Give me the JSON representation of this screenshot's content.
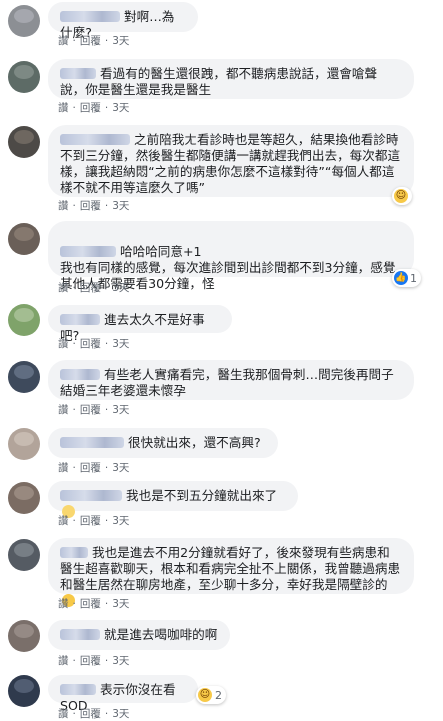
{
  "actions": {
    "read": "讚",
    "reply": "回覆",
    "time": "3天"
  },
  "comments": [
    {
      "text": "對啊…為什麼?",
      "avatar": [
        "#8c8f94",
        "#b9bcc2"
      ]
    },
    {
      "text": "看過有的醫生還很跩，都不聽病患說話，還會嗆聲說，你是醫生還是我是醫生",
      "avatar": [
        "#5d6b66",
        "#98a29c"
      ]
    },
    {
      "text": "之前陪我ㄤ看診時也是等超久，結果換他看診時不到三分鐘，然後醫生都隨便講一講就趕我們出去，每次都這樣，讓我超納悶“之前的病患你怎麼不這樣對待”“每個人都這樣不就不用等這麼久了嗎”",
      "avatar": [
        "#4d4a47",
        "#8a7f75"
      ],
      "reaction_count": ""
    },
    {
      "text": "哈哈哈同意+1\n我也有同樣的感覺，每次進診間到出診間都不到3分鐘，感覺其他人都需要看30分鐘，怪",
      "avatar": [
        "#6a5f58",
        "#9a8c82"
      ],
      "reaction_count": "1"
    },
    {
      "text": "進去太久不是好事吧?",
      "avatar": [
        "#7fa36a",
        "#c1d4b0"
      ]
    },
    {
      "text": "有些老人實痛看完，醫生我那個骨刺…問完後再問子結婚三年老婆還未懷孕",
      "avatar": [
        "#3e4a5c",
        "#7c8aa0"
      ]
    },
    {
      "text": "很快就出來，還不高興?",
      "avatar": [
        "#b2a49a",
        "#d9cec5"
      ]
    },
    {
      "text": "我也是不到五分鐘就出來了",
      "avatar": [
        "#7b6c63",
        "#b0a398"
      ]
    },
    {
      "text": "我也是進去不用2分鐘就看好了，後來發現有些病患和醫生超喜歡聊天，根本和看病完全扯不上關係，我曾聽過病患和醫生居然在聊房地產，至少聊十多分，幸好我是隔壁診的",
      "avatar": [
        "#555b63",
        "#939aa3"
      ]
    },
    {
      "text": "就是進去喝咖啡的啊",
      "avatar": [
        "#7a6f6a",
        "#aca19a"
      ]
    },
    {
      "text": "表示你沒在看SOD",
      "avatar": [
        "#2f3a4d",
        "#6d7a92"
      ],
      "reaction_count": "2"
    }
  ]
}
